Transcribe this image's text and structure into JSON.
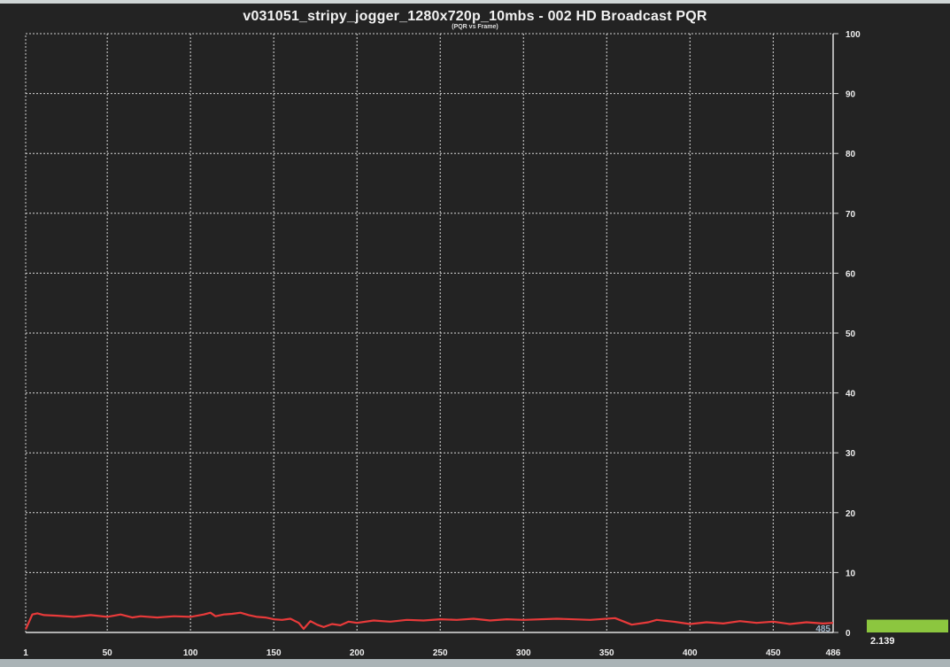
{
  "chart_data": {
    "type": "line",
    "title": "v031051_stripy_jogger_1280x720p_10mbs - 002 HD Broadcast PQR",
    "subtitle": "(PQR vs Frame)",
    "xlabel": "",
    "ylabel": "",
    "xlim": [
      1,
      486
    ],
    "ylim": [
      0,
      100
    ],
    "x_ticks": [
      "1",
      "50",
      "100",
      "150",
      "200",
      "250",
      "300",
      "350",
      "400",
      "450",
      "486"
    ],
    "x_tick_values": [
      1,
      50,
      100,
      150,
      200,
      250,
      300,
      350,
      400,
      450,
      486
    ],
    "y_ticks": [
      "0",
      "10",
      "20",
      "30",
      "40",
      "50",
      "60",
      "70",
      "80",
      "90",
      "100"
    ],
    "y_tick_values": [
      0,
      10,
      20,
      30,
      40,
      50,
      60,
      70,
      80,
      90,
      100
    ],
    "grid": true,
    "legend": "none",
    "end_frame_label": "485",
    "series": [
      {
        "color": "#e83a3a",
        "x": [
          1,
          5,
          8,
          12,
          20,
          30,
          40,
          50,
          58,
          65,
          70,
          80,
          90,
          100,
          108,
          112,
          115,
          120,
          125,
          130,
          135,
          140,
          145,
          150,
          155,
          160,
          165,
          168,
          172,
          176,
          180,
          185,
          190,
          195,
          200,
          210,
          220,
          230,
          240,
          250,
          260,
          270,
          280,
          290,
          300,
          320,
          340,
          355,
          365,
          375,
          380,
          390,
          400,
          410,
          420,
          430,
          440,
          450,
          460,
          470,
          480,
          486
        ],
        "values": [
          0.5,
          3.0,
          3.2,
          2.9,
          2.8,
          2.6,
          2.9,
          2.6,
          3.0,
          2.5,
          2.7,
          2.5,
          2.7,
          2.6,
          3.0,
          3.3,
          2.7,
          3.0,
          3.1,
          3.3,
          2.9,
          2.6,
          2.5,
          2.2,
          2.1,
          2.3,
          1.6,
          0.6,
          1.9,
          1.3,
          0.9,
          1.4,
          1.2,
          1.8,
          1.6,
          2.0,
          1.8,
          2.1,
          2.0,
          2.2,
          2.1,
          2.3,
          2.0,
          2.2,
          2.1,
          2.3,
          2.1,
          2.4,
          1.3,
          1.7,
          2.1,
          1.8,
          1.4,
          1.7,
          1.5,
          1.9,
          1.6,
          1.8,
          1.4,
          1.7,
          1.5,
          1.6
        ]
      }
    ],
    "summary_bar": {
      "value": 2.139,
      "label": "2.139",
      "color": "#8cc63f"
    }
  }
}
